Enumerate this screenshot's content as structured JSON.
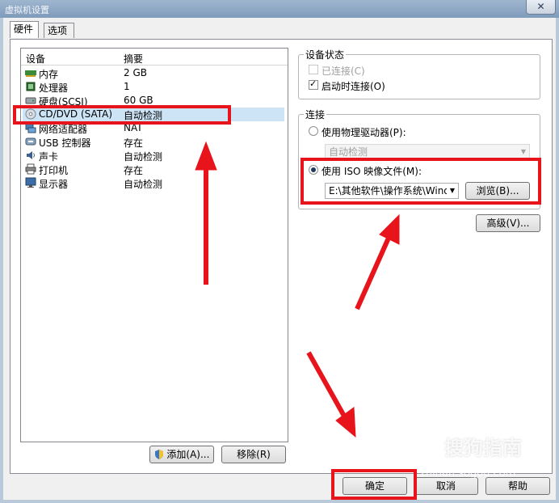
{
  "window": {
    "title": "虚拟机设置",
    "close_glyph": "✕"
  },
  "tabs": [
    {
      "label": "硬件",
      "active": true
    },
    {
      "label": "选项",
      "active": false
    }
  ],
  "device_list": {
    "columns": [
      "设备",
      "摘要"
    ],
    "rows": [
      {
        "device": "内存",
        "summary": "2 GB",
        "icon": "memory-icon"
      },
      {
        "device": "处理器",
        "summary": "1",
        "icon": "processor-icon"
      },
      {
        "device": "硬盘(SCSI)",
        "summary": "60 GB",
        "icon": "hard-disk-icon"
      },
      {
        "device": "CD/DVD (SATA)",
        "summary": "自动检测",
        "icon": "cd-dvd-icon",
        "selected": true
      },
      {
        "device": "网络适配器",
        "summary": "NAT",
        "icon": "network-adapter-icon"
      },
      {
        "device": "USB 控制器",
        "summary": "存在",
        "icon": "usb-icon"
      },
      {
        "device": "声卡",
        "summary": "自动检测",
        "icon": "sound-card-icon"
      },
      {
        "device": "打印机",
        "summary": "存在",
        "icon": "printer-icon"
      },
      {
        "device": "显示器",
        "summary": "自动检测",
        "icon": "display-icon"
      }
    ],
    "add_label": "添加(A)...",
    "remove_label": "移除(R)"
  },
  "device_status": {
    "title": "设备状态",
    "connected_label": "已连接(C)",
    "connected_checked": false,
    "connect_at_power_on_label": "启动时连接(O)",
    "connect_at_power_on_checked": true
  },
  "connection": {
    "title": "连接",
    "physical_label": "使用物理驱动器(P):",
    "physical_value": "自动检测",
    "iso_label": "使用 ISO 映像文件(M):",
    "iso_value": "E:\\其他软件\\操作系统\\Windo",
    "browse_label": "浏览(B)...",
    "selected": "iso"
  },
  "advanced_label": "高级(V)...",
  "footer": {
    "ok_label": "确定",
    "cancel_label": "取消",
    "help_label": "帮助"
  },
  "watermark": {
    "text": "搜狗指南",
    "url": "zhinan.sogou.com"
  },
  "colors": {
    "annotation_red": "#e8141b",
    "selection": "#cde4f7"
  }
}
